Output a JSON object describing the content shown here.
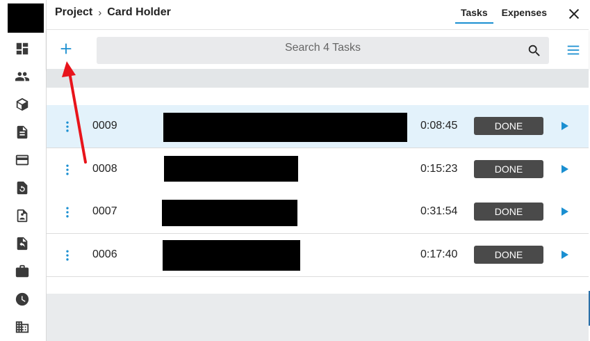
{
  "breadcrumb": {
    "project": "Project",
    "separator": "›",
    "current": "Card Holder"
  },
  "tabs": [
    {
      "label": "Tasks",
      "active": true
    },
    {
      "label": "Expenses",
      "active": false
    }
  ],
  "search": {
    "placeholder": "Search 4 Tasks",
    "value": ""
  },
  "sidebar": {
    "icons": [
      "dashboard-icon",
      "people-icon",
      "cube-icon",
      "document-icon",
      "credit-card-icon",
      "history-icon",
      "contact-document-icon",
      "document-undo-icon",
      "briefcase-icon",
      "clock-icon",
      "building-icon"
    ]
  },
  "tasks": [
    {
      "id": "0009",
      "duration": "0:08:45",
      "status_label": "DONE",
      "selected": true
    },
    {
      "id": "0008",
      "duration": "0:15:23",
      "status_label": "DONE",
      "selected": false
    },
    {
      "id": "0007",
      "duration": "0:31:54",
      "status_label": "DONE",
      "selected": false
    },
    {
      "id": "0006",
      "duration": "0:17:40",
      "status_label": "DONE",
      "selected": false
    }
  ],
  "colors": {
    "accent": "#1a8fd1",
    "done_button": "#4a4a4a",
    "selected_row": "#e3f2fb",
    "annotation_arrow": "#e8141b"
  }
}
